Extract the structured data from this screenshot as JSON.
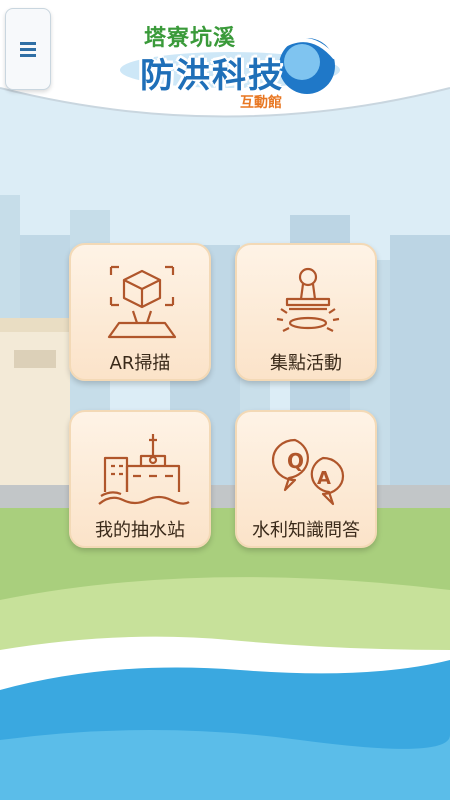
{
  "header": {
    "logo_line1": "塔寮坑溪",
    "logo_line2": "防洪科技",
    "logo_line3": "互動館"
  },
  "menu": {
    "icon": "hamburger-menu-icon"
  },
  "cards": [
    {
      "label": "AR掃描",
      "icon": "ar-scan-icon"
    },
    {
      "label": "集點活動",
      "icon": "stamp-icon"
    },
    {
      "label": "我的抽水站",
      "icon": "pump-station-icon"
    },
    {
      "label": "水利知識問答",
      "icon": "qa-chat-icon"
    }
  ],
  "colors": {
    "sky": "#d8ebf5",
    "buildings": "#c3dbe8",
    "grass": "#a9cf7d",
    "water": "#3aa8e0",
    "icon_stroke": "#b0562b",
    "card": "#fdeedd"
  }
}
